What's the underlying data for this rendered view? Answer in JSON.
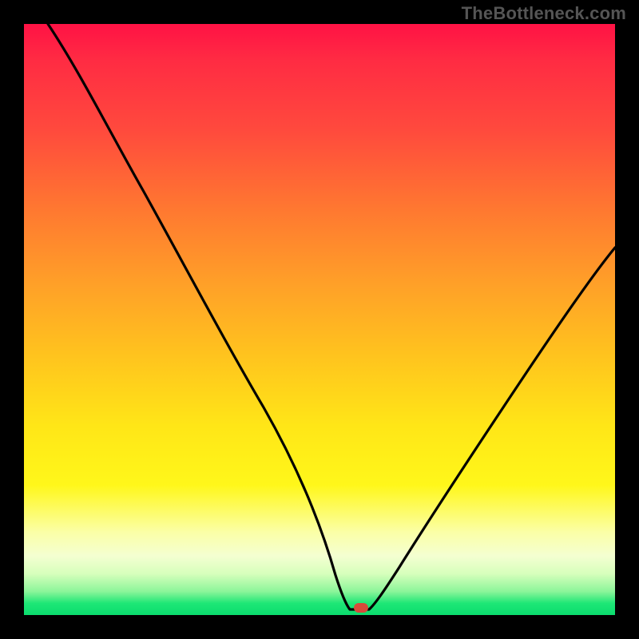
{
  "watermark": "TheBottleneck.com",
  "colors": {
    "frame": "#000000",
    "curve": "#000000",
    "marker": "#d84a3a",
    "gradient_top": "#ff1245",
    "gradient_bottom": "#0bdc6e"
  },
  "chart_data": {
    "type": "line",
    "title": "",
    "xlabel": "",
    "ylabel": "",
    "xlim": [
      0,
      100
    ],
    "ylim": [
      0,
      100
    ],
    "annotations": [],
    "series": [
      {
        "name": "curve",
        "x": [
          4,
          10,
          18,
          26,
          32,
          38,
          44,
          49,
          52,
          54,
          56,
          58,
          62,
          68,
          76,
          84,
          92,
          100
        ],
        "y": [
          100,
          89,
          76,
          62,
          52,
          41,
          28,
          14,
          5,
          1,
          0,
          0,
          4,
          12,
          24,
          36,
          49,
          62
        ]
      }
    ],
    "marker": {
      "x": 57,
      "y": 1.5
    },
    "flat_bottom": {
      "x_start": 52,
      "x_end": 58,
      "y": 0
    }
  }
}
